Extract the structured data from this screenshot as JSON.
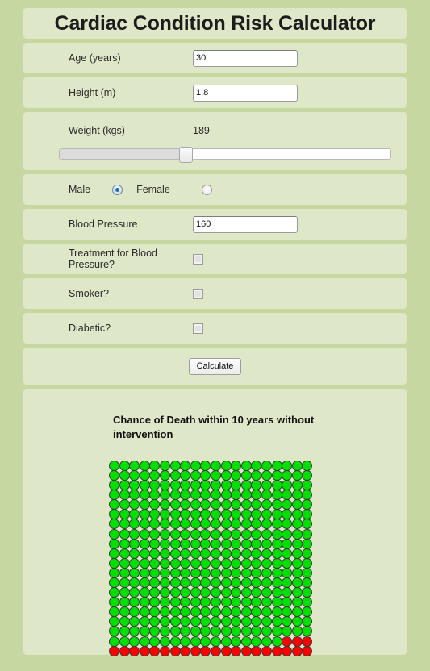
{
  "header": {
    "title": "Cardiac Condition Risk Calculator"
  },
  "form": {
    "age": {
      "label": "Age (years)",
      "value": "30"
    },
    "height": {
      "label": "Height (m)",
      "value": "1.8"
    },
    "weight": {
      "label": "Weight (kgs)",
      "value": "189",
      "slider_percent": 38
    },
    "gender": {
      "male_label": "Male",
      "male_selected": true,
      "female_label": "Female",
      "female_selected": false
    },
    "blood_pressure": {
      "label": "Blood Pressure",
      "value": "160"
    },
    "treatment": {
      "label": "Treatment for Blood Pressure?",
      "checked": false
    },
    "smoker": {
      "label": "Smoker?",
      "checked": false
    },
    "diabetic": {
      "label": "Diabetic?",
      "checked": false
    },
    "calculate_label": "Calculate"
  },
  "result": {
    "heading": "Chance of Death within 10 years without intervention"
  },
  "chart_data": {
    "type": "pictogram",
    "title": "Chance of Death within 10 years without intervention",
    "rows": 20,
    "columns": 20,
    "total_dots": 400,
    "risk_dots": 23,
    "safe_dots": 377,
    "risk_percent": 5.75,
    "risk_color": "#fc0000",
    "safe_color": "#00e000",
    "dot_outline_color": "#3a3a3a",
    "legend": [],
    "note": "Filled left-to-right, top-to-bottom with safe dots; risk dots fill the final 23 cells (bottom-right)."
  },
  "colors": {
    "page_background": "#c7d7a2",
    "panel_background": "#dee8c9",
    "title_background": "#ffffff"
  }
}
